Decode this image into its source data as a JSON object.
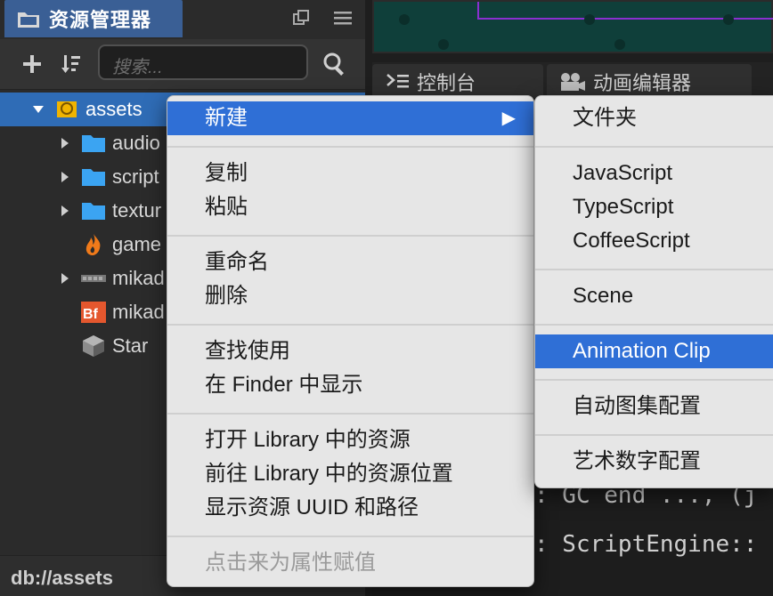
{
  "assets_panel": {
    "title": "资源管理器",
    "search_placeholder": "搜索...",
    "tree": [
      {
        "label": "assets",
        "icon": "assets-db-icon",
        "expanded": true
      },
      {
        "label": "audio",
        "icon": "folder-icon"
      },
      {
        "label": "script",
        "icon": "folder-icon"
      },
      {
        "label": "textur",
        "icon": "folder-icon"
      },
      {
        "label": "game",
        "icon": "fire-icon"
      },
      {
        "label": "mikad",
        "icon": "sprite-atlas-icon"
      },
      {
        "label": "mikad",
        "icon": "bitmap-font-icon"
      },
      {
        "label": "Star",
        "icon": "cube-icon"
      }
    ],
    "status_path": "db://assets"
  },
  "dock": {
    "console_tab": "控制台",
    "animation_tab": "动画编辑器"
  },
  "console_lines": [
    ": GC end ..., (j",
    ": ScriptEngine::"
  ],
  "context_menu": {
    "items": {
      "new": "新建",
      "copy": "复制",
      "paste": "粘贴",
      "rename": "重命名",
      "delete": "删除",
      "find_usage": "查找使用",
      "reveal_finder": "在 Finder 中显示",
      "open_library": "打开 Library 中的资源",
      "goto_library": "前往 Library 中的资源位置",
      "show_uuid": "显示资源 UUID 和路径",
      "assign_prop": "点击来为属性赋值"
    },
    "submenu_arrow": "▶"
  },
  "submenu": {
    "folder": "文件夹",
    "javascript": "JavaScript",
    "typescript": "TypeScript",
    "coffeescript": "CoffeeScript",
    "scene": "Scene",
    "animation_clip": "Animation Clip",
    "auto_atlas": "自动图集配置",
    "label_atlas": "艺术数字配置"
  },
  "colors": {
    "selection": "#2f6fd6",
    "tab_active": "#3a5f95",
    "menu_bg": "#e6e6e6"
  }
}
